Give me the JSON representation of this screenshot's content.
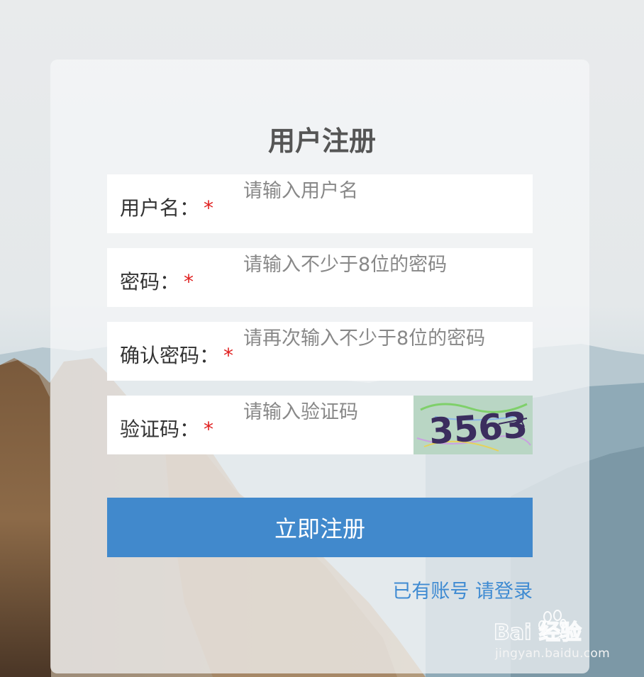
{
  "form": {
    "title": "用户注册",
    "username": {
      "label": "用户名：",
      "required_mark": "*",
      "placeholder": "请输入用户名"
    },
    "password": {
      "label": "密码：",
      "required_mark": "*",
      "placeholder": "请输入不少于8位的密码"
    },
    "confirm": {
      "label": "确认密码：",
      "required_mark": "*",
      "placeholder": "请再次输入不少于8位的密码"
    },
    "captcha": {
      "label": "验证码：",
      "required_mark": "*",
      "placeholder": "请输入验证码",
      "image_text": "3563"
    },
    "submit_label": "立即注册",
    "login_link": "已有账号 请登录"
  },
  "watermark": {
    "brand": "Bai 经验",
    "url": "jingyan.baidu.com"
  },
  "colors": {
    "accent": "#4189cc",
    "link": "#3f8bd2",
    "required": "#e02020"
  }
}
